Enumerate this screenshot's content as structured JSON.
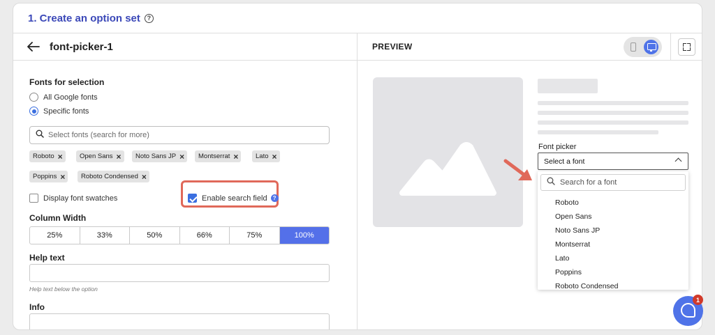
{
  "header": {
    "title": "1. Create an option set",
    "help_glyph": "?"
  },
  "editor": {
    "title": "font-picker-1",
    "fonts_section_label": "Fonts for selection",
    "radio_options": [
      {
        "label": "All Google fonts",
        "checked": false
      },
      {
        "label": "Specific fonts",
        "checked": true
      }
    ],
    "font_search_placeholder": "Select fonts (search for more)",
    "selected_fonts": [
      "Roboto",
      "Open Sans",
      "Noto Sans JP",
      "Montserrat",
      "Lato",
      "Poppins",
      "Roboto Condensed"
    ],
    "display_swatches": {
      "label": "Display font swatches",
      "checked": false
    },
    "enable_search": {
      "label": "Enable search field",
      "checked": true,
      "info_glyph": "?"
    },
    "column_width_label": "Column Width",
    "column_width_options": [
      "25%",
      "33%",
      "50%",
      "66%",
      "75%",
      "100%"
    ],
    "column_width_selected": "100%",
    "help_text_label": "Help text",
    "help_text_value": "",
    "help_text_hint": "Help text below the option",
    "info_label": "Info"
  },
  "preview": {
    "label": "PREVIEW",
    "device_selected": "desktop",
    "font_picker_label": "Font picker",
    "select_placeholder": "Select a font",
    "dropdown_search_placeholder": "Search for a font",
    "dropdown_items": [
      "Roboto",
      "Open Sans",
      "Noto Sans JP",
      "Montserrat",
      "Lato",
      "Poppins",
      "Roboto Condensed"
    ]
  },
  "chat": {
    "badge_count": "1"
  },
  "colors": {
    "accent": "#4f73e8",
    "title": "#3b48b8",
    "highlight": "#e0695a",
    "badge": "#d13a2a"
  }
}
